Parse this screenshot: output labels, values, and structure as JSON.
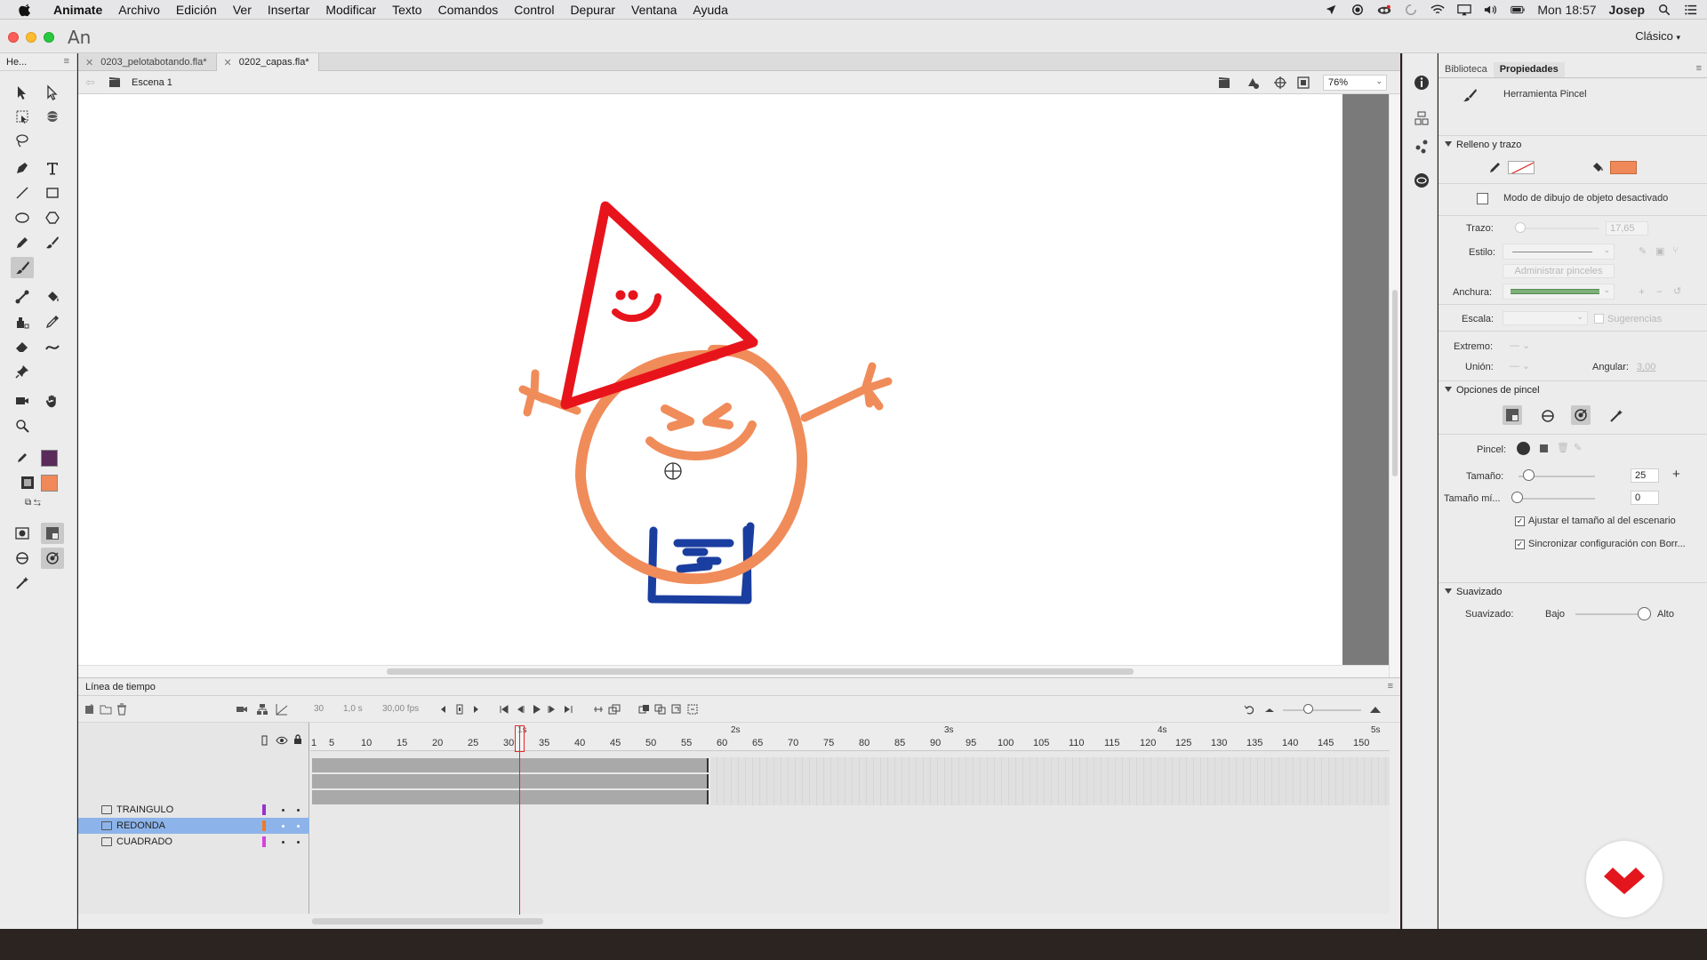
{
  "menubar": {
    "app": "Animate",
    "items": [
      "Archivo",
      "Edición",
      "Ver",
      "Insertar",
      "Modificar",
      "Texto",
      "Comandos",
      "Control",
      "Depurar",
      "Ventana",
      "Ayuda"
    ],
    "clock": "Mon 18:57",
    "user": "Josep"
  },
  "window": {
    "logo": "An",
    "workspace": "Clásico"
  },
  "tools_panel": {
    "header": "He..."
  },
  "documents": {
    "tabs": [
      {
        "label": "0203_pelotabotando.fla*",
        "active": false
      },
      {
        "label": "0202_capas.fla*",
        "active": true
      }
    ],
    "scene": "Escena 1",
    "zoom": "76%"
  },
  "timeline": {
    "title": "Línea de tiempo",
    "frame_current": "30",
    "time_current": "1,0 s",
    "fps": "30,00 fps",
    "ruler_ticks": [
      "1",
      "5",
      "10",
      "15",
      "20",
      "25",
      "30",
      "35",
      "40",
      "45",
      "50",
      "55",
      "60",
      "65",
      "70",
      "75",
      "80",
      "85",
      "90",
      "95",
      "100",
      "105",
      "110",
      "115",
      "120",
      "125",
      "130",
      "135",
      "140",
      "145",
      "150"
    ],
    "seconds": [
      "1s",
      "2s",
      "3s",
      "4s",
      "5s"
    ],
    "layers": [
      {
        "name": "TRAINGULO",
        "color": "#9b30d0",
        "selected": false
      },
      {
        "name": "REDONDA",
        "color": "#f07a2a",
        "selected": true
      },
      {
        "name": "CUADRADO",
        "color": "#d840e0",
        "selected": false
      }
    ]
  },
  "properties": {
    "tabs": [
      "Biblioteca",
      "Propiedades"
    ],
    "tool_name": "Herramienta Pincel",
    "section_fill": "Relleno y trazo",
    "object_mode": "Modo de dibujo de objeto desactivado",
    "stroke_label": "Trazo:",
    "stroke_value": "17,65",
    "style_label": "Estilo:",
    "manage_brushes": "Administrar pinceles",
    "width_label": "Anchura:",
    "scale_label": "Escala:",
    "hints_label": "Sugerencias",
    "cap_label": "Extremo:",
    "join_label": "Unión:",
    "angular_label": "Angular:",
    "angular_value": "3,00",
    "section_brush": "Opciones de pincel",
    "brush_label": "Pincel:",
    "size_label": "Tamaño:",
    "size_value": "25",
    "minsize_label": "Tamaño mí...",
    "minsize_value": "0",
    "check_adjust": "Ajustar el tamaño al del escenario",
    "check_sync": "Sincronizar configuración con Borr...",
    "section_smooth": "Suavizado",
    "smooth_label": "Suavizado:",
    "smooth_low": "Bajo",
    "smooth_high": "Alto",
    "fill_color": "#f0895a"
  },
  "colors": {
    "stroke_swatch": "#5a2a5a",
    "fill_swatch": "#f0895a",
    "triangle": "#e8141c",
    "circle": "#f08c5a",
    "square": "#1a3ea0"
  }
}
